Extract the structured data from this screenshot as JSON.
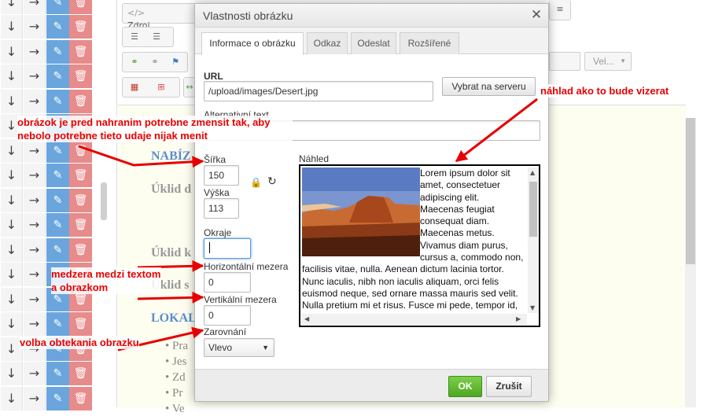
{
  "left_list": {
    "rows": 17,
    "down_icon": "arrow-down-icon",
    "right_icon": "arrow-right-icon",
    "edit_icon": "edit-icon",
    "delete_icon": "trash-icon",
    "edit_color": "#6aa6dd",
    "delete_color": "#e88b8b"
  },
  "toolbar": {
    "source_label": "Zdroj",
    "style_combo": "Vel..."
  },
  "document": {
    "lines": [
      "NABÍZ",
      "Úklid d",
      "Úklid k",
      "Úklid s",
      "LOKAL"
    ],
    "bullets": [
      "Pra",
      "Jes",
      "Zd",
      "Pr",
      "Ve"
    ]
  },
  "dialog": {
    "title": "Vlastnosti obrázku",
    "close_label": "✕",
    "tabs": [
      "Informace o obrázku",
      "Odkaz",
      "Odeslat",
      "Rozšířené"
    ],
    "active_tab": 0,
    "url_label": "URL",
    "url_value": "/upload/images/Desert.jpg",
    "browse_button": "Vybrat na serveru",
    "alt_label": "Alternativní text",
    "alt_value": "",
    "width_label": "Šířka",
    "width_value": "150",
    "height_label": "Výška",
    "height_value": "113",
    "border_label": "Okraje",
    "border_value": "",
    "hspace_label": "Horizontální mezera",
    "hspace_value": "0",
    "vspace_label": "Vertikální mezera",
    "vspace_value": "0",
    "align_label": "Zarovnání",
    "align_value": "Vlevo",
    "preview_label": "Náhled",
    "preview_text": "Lorem ipsum dolor sit amet, consectetuer adipiscing elit. Maecenas feugiat consequat diam. Maecenas metus. Vivamus diam purus, cursus a, commodo non, facilisis vitae, nulla. Aenean dictum lacinia tortor. Nunc iaculis, nibh non iaculis aliquam, orci felis euismod neque, sed ornare massa mauris sed velit. Nulla pretium mi et risus. Fusce mi pede, tempor id, cursus ac, ullamcorper nec, enim. Sed tortor.",
    "ok_button": "OK",
    "cancel_button": "Zrušit",
    "ok_color": "#5cb82e"
  },
  "annotations": {
    "preview_note": "náhlad ako to bude vizerat",
    "size_note": "obrázok je pred nahranim potrebne zmensit tak, aby nebolo potrebne tieto udaje nijak menit",
    "spacing_note": "medzera medzi textom a obrazkom",
    "wrap_note": "volba obtekania obrazku",
    "color": "#e60000"
  }
}
